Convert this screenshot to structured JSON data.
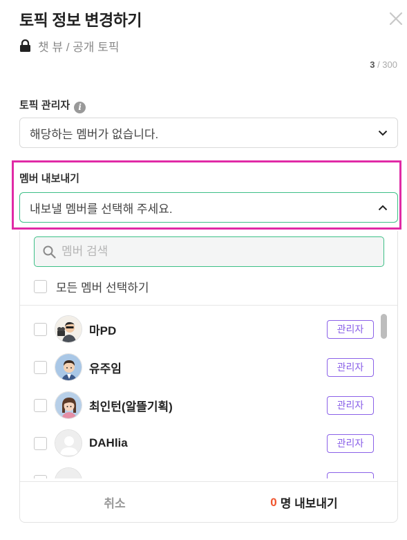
{
  "modal": {
    "title": "토픽 정보 변경하기",
    "subtitle": "챗 뷰 / 공개 토픽",
    "counter_current": "3",
    "counter_total": " / 300"
  },
  "admin_section": {
    "label": "토픽 관리자",
    "select_value": "해당하는 멤버가 없습니다."
  },
  "export_section": {
    "label": "멤버 내보내기",
    "select_value": "내보낼 멤버를 선택해 주세요."
  },
  "search": {
    "placeholder": "멤버 검색"
  },
  "select_all_label": "모든 멤버 선택하기",
  "members": [
    {
      "name": "마PD",
      "role": "관리자"
    },
    {
      "name": "유주임",
      "role": "관리자"
    },
    {
      "name": "최인턴(알뜰기획)",
      "role": "관리자"
    },
    {
      "name": "DAHlia",
      "role": "관리자"
    }
  ],
  "footer": {
    "cancel_label": "취소",
    "export_count": "0",
    "export_label": "명 내보내기"
  },
  "colors": {
    "accent_green": "#3cbf86",
    "highlight_pink": "#e02aa6",
    "badge_purple": "#8a60e8",
    "count_orange": "#f0542d"
  }
}
